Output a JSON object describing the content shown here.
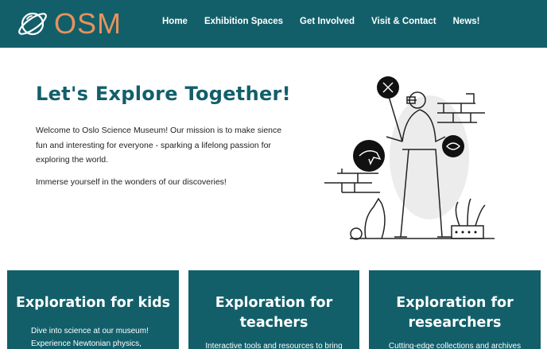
{
  "brand": {
    "name": "OSM"
  },
  "nav": {
    "items": [
      {
        "label": "Home"
      },
      {
        "label": "Exhibition Spaces"
      },
      {
        "label": "Get Involved"
      },
      {
        "label": "Visit & Contact"
      },
      {
        "label": "News!"
      }
    ]
  },
  "hero": {
    "title": "Let's Explore Together!",
    "paragraph1": "Welcome to Oslo Science Museum! Our mission is to make sience fun and interesting for everyone - sparking a lifelong passion for exploring the world.",
    "paragraph2": "Immerse yourself in the wonders of our discoveries!"
  },
  "cards": [
    {
      "title": "Exploration for kids",
      "text": "Dive into science at our museum! Experience Newtonian physics,"
    },
    {
      "title": "Exploration for teachers",
      "text": "Interactive tools and resources to bring"
    },
    {
      "title": "Exploration for researchers",
      "text": "Cutting-edge collections and archives"
    }
  ],
  "colors": {
    "header": "#125f6a",
    "brand": "#e8925c",
    "title": "#125f6a"
  },
  "icons": [
    "planet-logo-icon",
    "vr-explorer-illustration"
  ]
}
